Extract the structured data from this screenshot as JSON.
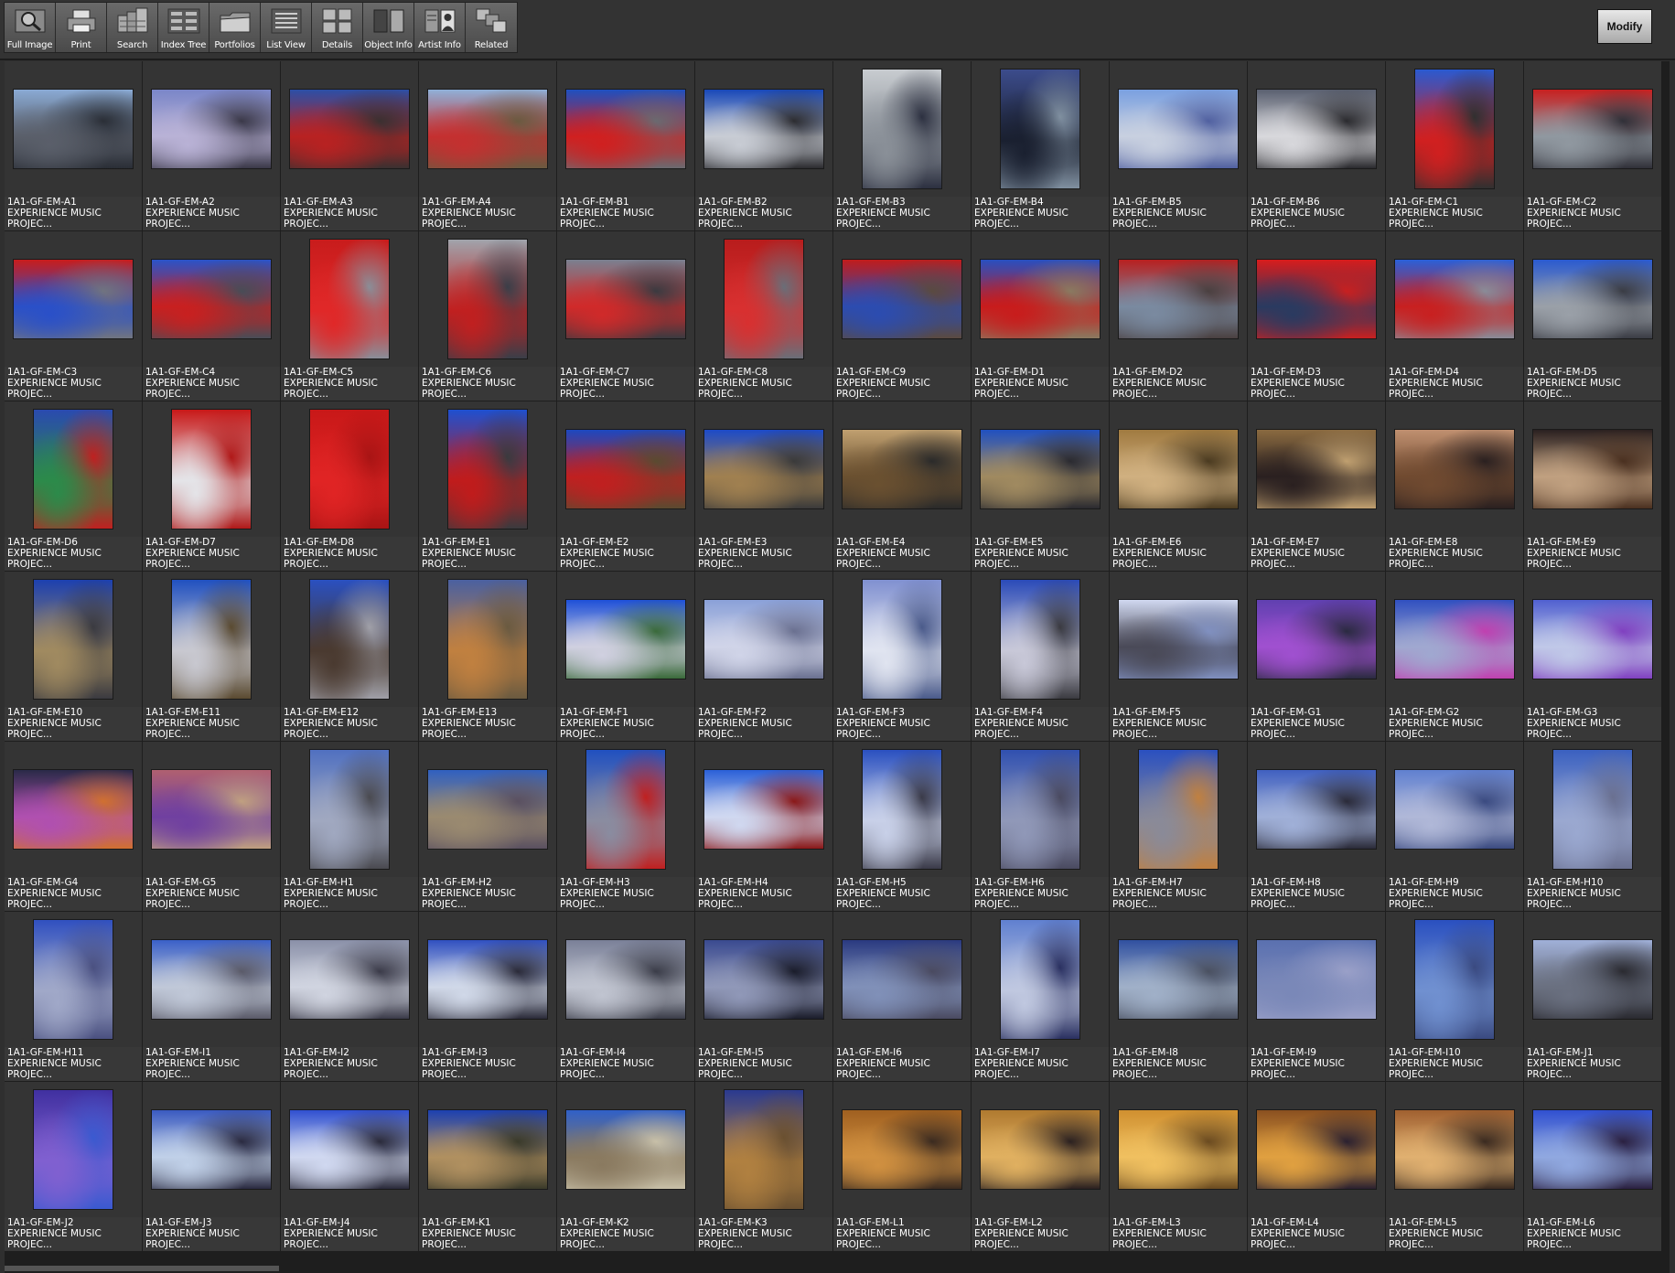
{
  "toolbar": {
    "tools": [
      {
        "label": "Full Image",
        "icon": "magnifier-icon"
      },
      {
        "label": "Print",
        "icon": "printer-icon"
      },
      {
        "label": "Search",
        "icon": "search-cards-icon"
      },
      {
        "label": "Index Tree",
        "icon": "index-tree-icon"
      },
      {
        "label": "Portfolios",
        "icon": "folder-icon"
      },
      {
        "label": "List View",
        "icon": "list-view-icon"
      },
      {
        "label": "Details",
        "icon": "details-icon"
      },
      {
        "label": "Object Info",
        "icon": "object-info-icon"
      },
      {
        "label": "Artist  Info",
        "icon": "artist-info-icon"
      },
      {
        "label": "Related",
        "icon": "related-icon"
      }
    ],
    "modify_label": "Modify"
  },
  "caption_subtitle": "EXPERIENCE MUSIC",
  "caption_trail": "PROJEC...",
  "thumbnails": [
    "1A1-GF-EM-A1",
    "1A1-GF-EM-A2",
    "1A1-GF-EM-A3",
    "1A1-GF-EM-A4",
    "1A1-GF-EM-B1",
    "1A1-GF-EM-B2",
    "1A1-GF-EM-B3",
    "1A1-GF-EM-B4",
    "1A1-GF-EM-B5",
    "1A1-GF-EM-B6",
    "1A1-GF-EM-C1",
    "1A1-GF-EM-C2",
    "1A1-GF-EM-C3",
    "1A1-GF-EM-C4",
    "1A1-GF-EM-C5",
    "1A1-GF-EM-C6",
    "1A1-GF-EM-C7",
    "1A1-GF-EM-C8",
    "1A1-GF-EM-C9",
    "1A1-GF-EM-D1",
    "1A1-GF-EM-D2",
    "1A1-GF-EM-D3",
    "1A1-GF-EM-D4",
    "1A1-GF-EM-D5",
    "1A1-GF-EM-D6",
    "1A1-GF-EM-D7",
    "1A1-GF-EM-D8",
    "1A1-GF-EM-E1",
    "1A1-GF-EM-E2",
    "1A1-GF-EM-E3",
    "1A1-GF-EM-E4",
    "1A1-GF-EM-E5",
    "1A1-GF-EM-E6",
    "1A1-GF-EM-E7",
    "1A1-GF-EM-E8",
    "1A1-GF-EM-E9",
    "1A1-GF-EM-E10",
    "1A1-GF-EM-E11",
    "1A1-GF-EM-E12",
    "1A1-GF-EM-E13",
    "1A1-GF-EM-F1",
    "1A1-GF-EM-F2",
    "1A1-GF-EM-F3",
    "1A1-GF-EM-F4",
    "1A1-GF-EM-F5",
    "1A1-GF-EM-G1",
    "1A1-GF-EM-G2",
    "1A1-GF-EM-G3",
    "1A1-GF-EM-G4",
    "1A1-GF-EM-G5",
    "1A1-GF-EM-H1",
    "1A1-GF-EM-H2",
    "1A1-GF-EM-H3",
    "1A1-GF-EM-H4",
    "1A1-GF-EM-H5",
    "1A1-GF-EM-H6",
    "1A1-GF-EM-H7",
    "1A1-GF-EM-H8",
    "1A1-GF-EM-H9",
    "1A1-GF-EM-H10",
    "1A1-GF-EM-H11",
    "1A1-GF-EM-I1",
    "1A1-GF-EM-I2",
    "1A1-GF-EM-I3",
    "1A1-GF-EM-I4",
    "1A1-GF-EM-I5",
    "1A1-GF-EM-I6",
    "1A1-GF-EM-I7",
    "1A1-GF-EM-I8",
    "1A1-GF-EM-I9",
    "1A1-GF-EM-I10",
    "1A1-GF-EM-J1",
    "1A1-GF-EM-J2",
    "1A1-GF-EM-J3",
    "1A1-GF-EM-J4",
    "1A1-GF-EM-K1",
    "1A1-GF-EM-K2",
    "1A1-GF-EM-K3",
    "1A1-GF-EM-L1",
    "1A1-GF-EM-L2",
    "1A1-GF-EM-L3",
    "1A1-GF-EM-L4",
    "1A1-GF-EM-L5",
    "1A1-GF-EM-L6"
  ],
  "orientations": [
    "L",
    "L",
    "L",
    "L",
    "L",
    "L",
    "P",
    "P",
    "L",
    "L",
    "P",
    "L",
    "L",
    "L",
    "P",
    "P",
    "L",
    "P",
    "L",
    "L",
    "L",
    "L",
    "L",
    "L",
    "P",
    "P",
    "P",
    "P",
    "L",
    "L",
    "L",
    "L",
    "L",
    "L",
    "L",
    "L",
    "P",
    "P",
    "P",
    "P",
    "L",
    "L",
    "P",
    "P",
    "L",
    "L",
    "L",
    "L",
    "L",
    "L",
    "P",
    "L",
    "P",
    "L",
    "P",
    "P",
    "P",
    "L",
    "L",
    "P",
    "P",
    "L",
    "L",
    "L",
    "L",
    "L",
    "L",
    "P",
    "L",
    "L",
    "P",
    "L",
    "P",
    "L",
    "L",
    "L",
    "L",
    "P",
    "L",
    "L",
    "L",
    "L",
    "L",
    "L"
  ],
  "palettes": [
    [
      "#8aaad4",
      "#5a5f6a",
      "#2a2e36"
    ],
    [
      "#7a86c8",
      "#b9b2d6",
      "#3a3848"
    ],
    [
      "#2c4fa6",
      "#b82222",
      "#3a3030"
    ],
    [
      "#8fb0d8",
      "#c43030",
      "#6a5a40"
    ],
    [
      "#1e50c0",
      "#d02020",
      "#6a6a70"
    ],
    [
      "#1848b8",
      "#c8ccd4",
      "#2c2c30"
    ],
    [
      "#c8ccd0",
      "#8a9098",
      "#2c3040"
    ],
    [
      "#3c4c8c",
      "#1a2030",
      "#8090a0"
    ],
    [
      "#7aa0e0",
      "#c8d0e0",
      "#5060a0"
    ],
    [
      "#5a6070",
      "#d8d8dc",
      "#2a2a2e"
    ],
    [
      "#2a5ad0",
      "#d02020",
      "#303030"
    ],
    [
      "#c82020",
      "#9098a0",
      "#303038"
    ],
    [
      "#c81c1c",
      "#2a50c8",
      "#707480"
    ],
    [
      "#2a54c8",
      "#c82020",
      "#484c56"
    ],
    [
      "#c81c1c",
      "#e02828",
      "#8a8e98"
    ],
    [
      "#a0a4ac",
      "#c02020",
      "#3a3e48"
    ],
    [
      "#7a8090",
      "#d02a2a",
      "#3a3a40"
    ],
    [
      "#b81c1c",
      "#d83030",
      "#6a6e78"
    ],
    [
      "#c01c1c",
      "#2c4cb0",
      "#5a4a40"
    ],
    [
      "#2850c0",
      "#c81c1c",
      "#8a7a60"
    ],
    [
      "#b82020",
      "#7a8aa0",
      "#4a4040"
    ],
    [
      "#d81c1c",
      "#2a3a60",
      "#c82020"
    ],
    [
      "#2a60d8",
      "#c82020",
      "#8a8c98"
    ],
    [
      "#2a5ad0",
      "#9aa0a8",
      "#3a3c44"
    ],
    [
      "#2a4ab0",
      "#2c8a4a",
      "#c02020"
    ],
    [
      "#c81818",
      "#e4e4e8",
      "#b01818"
    ],
    [
      "#c81818",
      "#e02424",
      "#a81414"
    ],
    [
      "#1e50d0",
      "#c01c1c",
      "#3a3a3e"
    ],
    [
      "#1c48c0",
      "#c02020",
      "#5a4a30"
    ],
    [
      "#1c4ac8",
      "#a08050",
      "#3a3a3a"
    ],
    [
      "#c0a070",
      "#6a5030",
      "#2a2a2a"
    ],
    [
      "#2050c0",
      "#a08a60",
      "#2a2a30"
    ],
    [
      "#a07a40",
      "#d0b080",
      "#4a3a20"
    ],
    [
      "#8a6a40",
      "#2a2020",
      "#c0a070"
    ],
    [
      "#c09070",
      "#704a30",
      "#2a2020"
    ],
    [
      "#2a2020",
      "#c0a080",
      "#4a3020"
    ],
    [
      "#1c40b0",
      "#a08a60",
      "#3a3a40"
    ],
    [
      "#2050c0",
      "#c8c8d0",
      "#5a4a30"
    ],
    [
      "#2a50c0",
      "#4a3a30",
      "#a0a0a8"
    ],
    [
      "#4a60a0",
      "#c08040",
      "#6a5a40"
    ],
    [
      "#1e50d8",
      "#d0d0e0",
      "#3a6a3a"
    ],
    [
      "#8aa0d8",
      "#d0d4e8",
      "#6a7090"
    ],
    [
      "#8090d0",
      "#e0e4f0",
      "#4a5a8a"
    ],
    [
      "#2a4ab8",
      "#c8c8d8",
      "#3a3a40"
    ],
    [
      "#d0d8f0",
      "#4a4a58",
      "#8090c0"
    ],
    [
      "#6040b0",
      "#a050d0",
      "#2a2a40"
    ],
    [
      "#3050c0",
      "#a0a8d0",
      "#c040b0"
    ],
    [
      "#5060d0",
      "#c0c8e8",
      "#8040c0"
    ],
    [
      "#2a2a48",
      "#b050b0",
      "#d07030"
    ],
    [
      "#b06070",
      "#7040a0",
      "#c0a080"
    ],
    [
      "#5070c0",
      "#a0a8c0",
      "#4a4a50"
    ],
    [
      "#3060c0",
      "#9a8a70",
      "#5a5060"
    ],
    [
      "#2050c0",
      "#8a8ca0",
      "#c02020"
    ],
    [
      "#2a60d8",
      "#d0d8f0",
      "#8a1818"
    ],
    [
      "#2a50c0",
      "#c8d0e8",
      "#3a3a48"
    ],
    [
      "#3050b0",
      "#9098b8",
      "#4a4a60"
    ],
    [
      "#2a50c0",
      "#8a8a98",
      "#c08040"
    ],
    [
      "#4060c0",
      "#a0b0d8",
      "#2a2a38"
    ],
    [
      "#6080d0",
      "#b0b8d8",
      "#3a4a80"
    ],
    [
      "#3a60c0",
      "#9aa8d0",
      "#6a7090"
    ],
    [
      "#3050c0",
      "#a0a8c8",
      "#4a5080"
    ],
    [
      "#3a60c8",
      "#c0c8d8",
      "#5a5a68"
    ],
    [
      "#8a90a8",
      "#d0d4e0",
      "#3a3a48"
    ],
    [
      "#3050c0",
      "#d0d8e8",
      "#2a2a38"
    ],
    [
      "#7a8098",
      "#c0c4d0",
      "#3a3c48"
    ],
    [
      "#3a4a90",
      "#9098b8",
      "#1a1c2a"
    ],
    [
      "#2a3a80",
      "#8090b8",
      "#4a4a60"
    ],
    [
      "#6080d0",
      "#c0c8e0",
      "#2a3060"
    ],
    [
      "#3050a0",
      "#a0b0c8",
      "#4a5060"
    ],
    [
      "#5a70b0",
      "#7a88b8",
      "#9aa0c8"
    ],
    [
      "#2a50c0",
      "#7090d0",
      "#3a4a80"
    ],
    [
      "#a0b0d8",
      "#6a7080",
      "#2a2a30"
    ],
    [
      "#4030a0",
      "#8060d0",
      "#3a5ad0"
    ],
    [
      "#3a5ac0",
      "#c0d0e8",
      "#2a2a40"
    ],
    [
      "#3050d0",
      "#d0d8f0",
      "#2a2a3a"
    ],
    [
      "#1c40b0",
      "#b09060",
      "#3a3a2a"
    ],
    [
      "#3060c8",
      "#8a7a60",
      "#c8c0a8"
    ],
    [
      "#2a3a90",
      "#b08040",
      "#6a5030"
    ],
    [
      "#a06020",
      "#d09040",
      "#3a2a20"
    ],
    [
      "#b07a30",
      "#e0b060",
      "#2a2020"
    ],
    [
      "#d09030",
      "#f0c060",
      "#6a4a20"
    ],
    [
      "#8a5020",
      "#e0a040",
      "#2a2030"
    ],
    [
      "#a06030",
      "#e0b070",
      "#3a2a20"
    ],
    [
      "#3050d0",
      "#90a8e0",
      "#2a2040"
    ]
  ]
}
